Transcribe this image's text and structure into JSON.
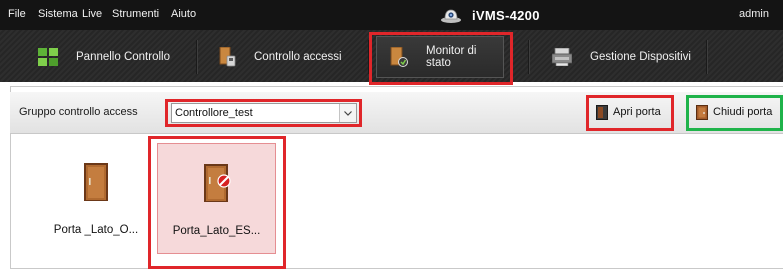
{
  "menubar": {
    "items": [
      "File",
      "Sistema",
      "Live",
      "Strumenti",
      "Aiuto"
    ],
    "app_title": "iVMS-4200",
    "user": "admin"
  },
  "tabs": [
    {
      "label": "Pannello Controllo",
      "icon": "control-panel-icon"
    },
    {
      "label": "Controllo accessi",
      "icon": "access-control-icon"
    },
    {
      "label": "Monitor di stato",
      "icon": "status-monitor-icon",
      "active": true
    },
    {
      "label": "Gestione Dispositivi",
      "icon": "device-management-icon"
    }
  ],
  "toolbar": {
    "group_label": "Gruppo controllo access",
    "group_value": "Controllore_test",
    "open_label": "Apri porta",
    "close_label": "Chiudi porta"
  },
  "doors": [
    {
      "label": "Porta _Lato_O...",
      "state": "normal"
    },
    {
      "label": "Porta_Lato_ES...",
      "state": "disabled",
      "selected": true
    }
  ],
  "colors": {
    "highlight_red": "#e0262a",
    "highlight_green": "#1fb34a",
    "door_brown": "#8b4a22",
    "menubar_bg": "#141414"
  }
}
